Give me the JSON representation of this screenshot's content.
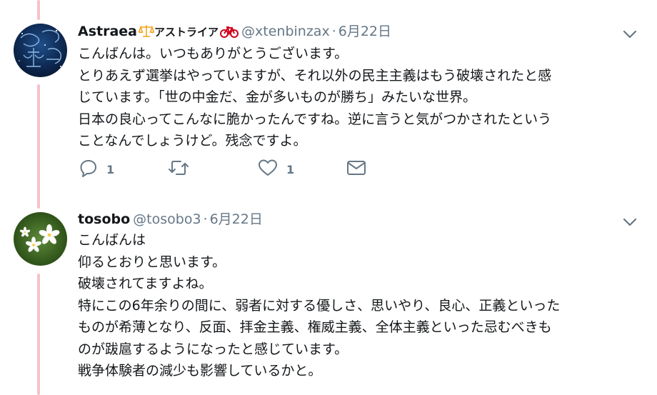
{
  "tweets": [
    {
      "name": "Astraea",
      "name_suffix": "アストライア",
      "handle": "@xtenbinzax",
      "separator": "·",
      "date": "6月22日",
      "lines": [
        "こんばんは。いつもありがとうございます。",
        "とりあえず選挙はやっていますが、それ以外の民主主義はもう破壊されたと感",
        "じています。「世の中金だ、金が多いものが勝ち」みたいな世界。",
        "日本の良心ってこんなに脆かったんですね。逆に言うと気がつかされたという",
        "ことなんでしょうけど。残念ですよ。"
      ],
      "reply_count": "1",
      "like_count": "1"
    },
    {
      "name": "tosobo",
      "handle": "@tosobo3",
      "separator": "·",
      "date": "6月22日",
      "lines": [
        "こんばんは",
        "仰るとおりと思います。",
        "破壊されてますよね。",
        "特にこの6年余りの間に、弱者に対する優しさ、思いやり、良心、正義といった",
        "ものが希薄となり、反面、拝金主義、権威主義、全体主義といった忌むべきも",
        "のが跋扈するようになったと感じています。",
        "戦争体験者の減少も影響しているかと。"
      ]
    }
  ],
  "icons": {
    "scales": "scales-icon",
    "bicycle": "bicycle-icon",
    "caret": "chevron-down-icon",
    "reply": "reply-icon",
    "retweet": "retweet-icon",
    "like": "heart-icon",
    "message": "envelope-icon"
  },
  "colors": {
    "thread_line": "#f4c2c8",
    "secondary_text": "#657786",
    "primary_text": "#14171a",
    "scales": "#f5a623",
    "bicycle": "#d0021b"
  }
}
